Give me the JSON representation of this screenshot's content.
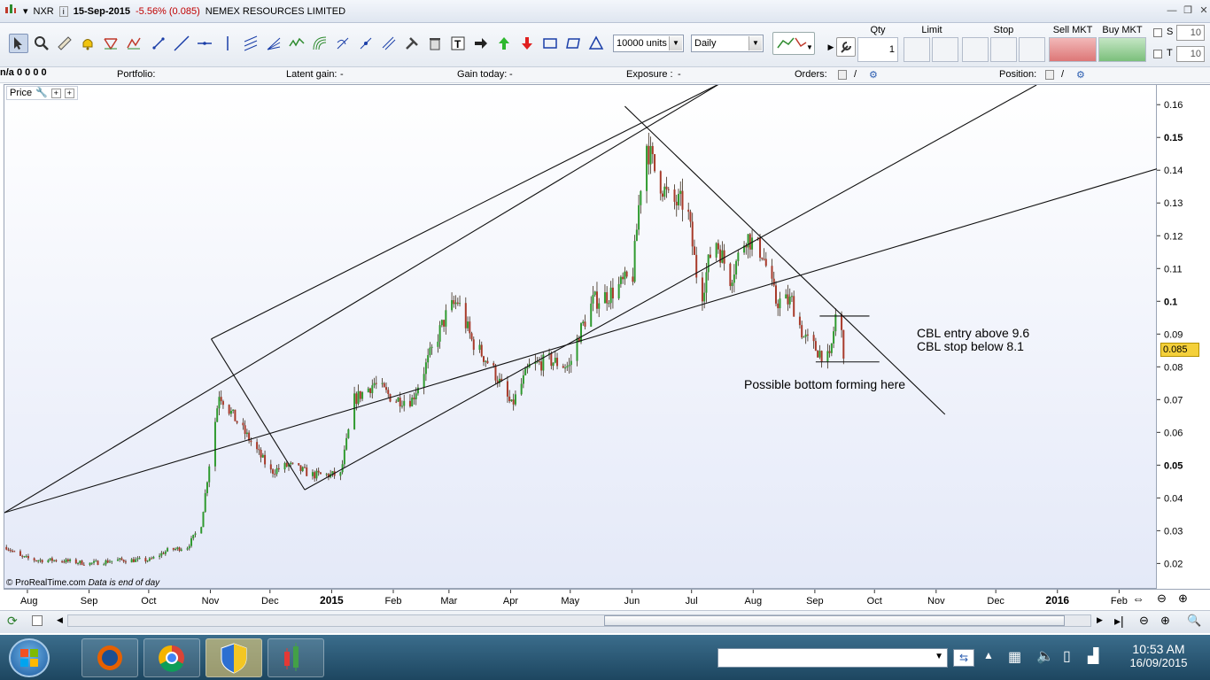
{
  "window": {
    "symbol": "NXR",
    "date": "15-Sep-2015",
    "change": "-5.56% (0.085)",
    "company": "NEMEX RESOURCES LIMITED"
  },
  "toolbar": {
    "quantity_select": "10000 units",
    "period_select": "Daily",
    "order_headers": {
      "qty": "Qty",
      "limit": "Limit",
      "stop": "Stop",
      "sell_mkt": "Sell MKT",
      "buy_mkt": "Buy MKT"
    },
    "qty_value": "1",
    "s_label": "S",
    "s_value": "10",
    "t_label": "T",
    "t_value": "10"
  },
  "infobar": {
    "portfolio": "Portfolio:",
    "portfolio_value": "n/a",
    "latent_gain": "Latent gain:",
    "latent_value": "-",
    "gain_today": "Gain today:",
    "gain_value": "-",
    "exposure": "Exposure :",
    "exposure_value": "-",
    "orders": "Orders:",
    "orders_a": "0",
    "orders_sep": "/",
    "orders_b": "0",
    "position": "Position:",
    "position_a": "0",
    "position_sep": "/",
    "position_b": "0"
  },
  "panel": {
    "price_label": "Price",
    "credit": "© ProRealTime.com",
    "credit_note": "Data is end of day"
  },
  "annotations": {
    "entry": "CBL entry above 9.6",
    "stop": "CBL stop below 8.1",
    "bottom": "Possible bottom forming here"
  },
  "price_tag": "0.085",
  "chart_data": {
    "type": "bar",
    "y_ticks": [
      "0.16",
      "0.15",
      "0.14",
      "0.13",
      "0.12",
      "0.11",
      "0.1",
      "0.09",
      "0.08",
      "0.07",
      "0.06",
      "0.05",
      "0.04",
      "0.03",
      "0.02"
    ],
    "y_tick_values": [
      0.16,
      0.15,
      0.14,
      0.13,
      0.12,
      0.11,
      0.1,
      0.09,
      0.08,
      0.07,
      0.06,
      0.05,
      0.04,
      0.03,
      0.02
    ],
    "x_ticks": [
      "Aug",
      "Sep",
      "Oct",
      "Nov",
      "Dec",
      "2015",
      "Feb",
      "Mar",
      "Apr",
      "May",
      "Jun",
      "Jul",
      "Aug",
      "Sep",
      "Oct",
      "Nov",
      "Dec",
      "2016",
      "Feb"
    ],
    "x_tick_dates": [
      "2014-08-01",
      "2014-09-01",
      "2014-10-01",
      "2014-11-01",
      "2014-12-01",
      "2015-01-01",
      "2015-02-01",
      "2015-03-01",
      "2015-04-01",
      "2015-05-01",
      "2015-06-01",
      "2015-07-01",
      "2015-08-01",
      "2015-09-01",
      "2015-10-01",
      "2015-11-01",
      "2015-12-01",
      "2016-01-01",
      "2016-02-01"
    ],
    "ylim": [
      0.012,
      0.166
    ],
    "xlim": [
      "2014-07-20",
      "2016-02-20"
    ],
    "last_price": 0.085,
    "price_path": [
      [
        "2014-07-21",
        0.025
      ],
      [
        "2014-07-28",
        0.022
      ],
      [
        "2014-08-05",
        0.021
      ],
      [
        "2014-08-15",
        0.021
      ],
      [
        "2014-09-01",
        0.02
      ],
      [
        "2014-09-15",
        0.021
      ],
      [
        "2014-10-01",
        0.021
      ],
      [
        "2014-10-10",
        0.024
      ],
      [
        "2014-10-20",
        0.025
      ],
      [
        "2014-10-27",
        0.032
      ],
      [
        "2014-11-01",
        0.055
      ],
      [
        "2014-11-05",
        0.072
      ],
      [
        "2014-11-12",
        0.065
      ],
      [
        "2014-11-20",
        0.058
      ],
      [
        "2014-12-01",
        0.048
      ],
      [
        "2014-12-10",
        0.05
      ],
      [
        "2014-12-22",
        0.047
      ],
      [
        "2015-01-05",
        0.047
      ],
      [
        "2015-01-12",
        0.07
      ],
      [
        "2015-01-22",
        0.075
      ],
      [
        "2015-02-01",
        0.07
      ],
      [
        "2015-02-10",
        0.07
      ],
      [
        "2015-02-20",
        0.085
      ],
      [
        "2015-02-28",
        0.097
      ],
      [
        "2015-03-05",
        0.1
      ],
      [
        "2015-03-12",
        0.088
      ],
      [
        "2015-03-22",
        0.08
      ],
      [
        "2015-04-01",
        0.068
      ],
      [
        "2015-04-10",
        0.08
      ],
      [
        "2015-04-20",
        0.082
      ],
      [
        "2015-04-30",
        0.08
      ],
      [
        "2015-05-05",
        0.09
      ],
      [
        "2015-05-12",
        0.1
      ],
      [
        "2015-05-20",
        0.102
      ],
      [
        "2015-06-01",
        0.108
      ],
      [
        "2015-06-07",
        0.15
      ],
      [
        "2015-06-12",
        0.14
      ],
      [
        "2015-06-20",
        0.13
      ],
      [
        "2015-06-28",
        0.13
      ],
      [
        "2015-07-05",
        0.1
      ],
      [
        "2015-07-12",
        0.12
      ],
      [
        "2015-07-20",
        0.107
      ],
      [
        "2015-07-28",
        0.12
      ],
      [
        "2015-08-05",
        0.115
      ],
      [
        "2015-08-12",
        0.1
      ],
      [
        "2015-08-20",
        0.1
      ],
      [
        "2015-08-26",
        0.089
      ],
      [
        "2015-09-02",
        0.085
      ],
      [
        "2015-09-08",
        0.082
      ],
      [
        "2015-09-12",
        0.1
      ],
      [
        "2015-09-15",
        0.085
      ]
    ]
  }
}
